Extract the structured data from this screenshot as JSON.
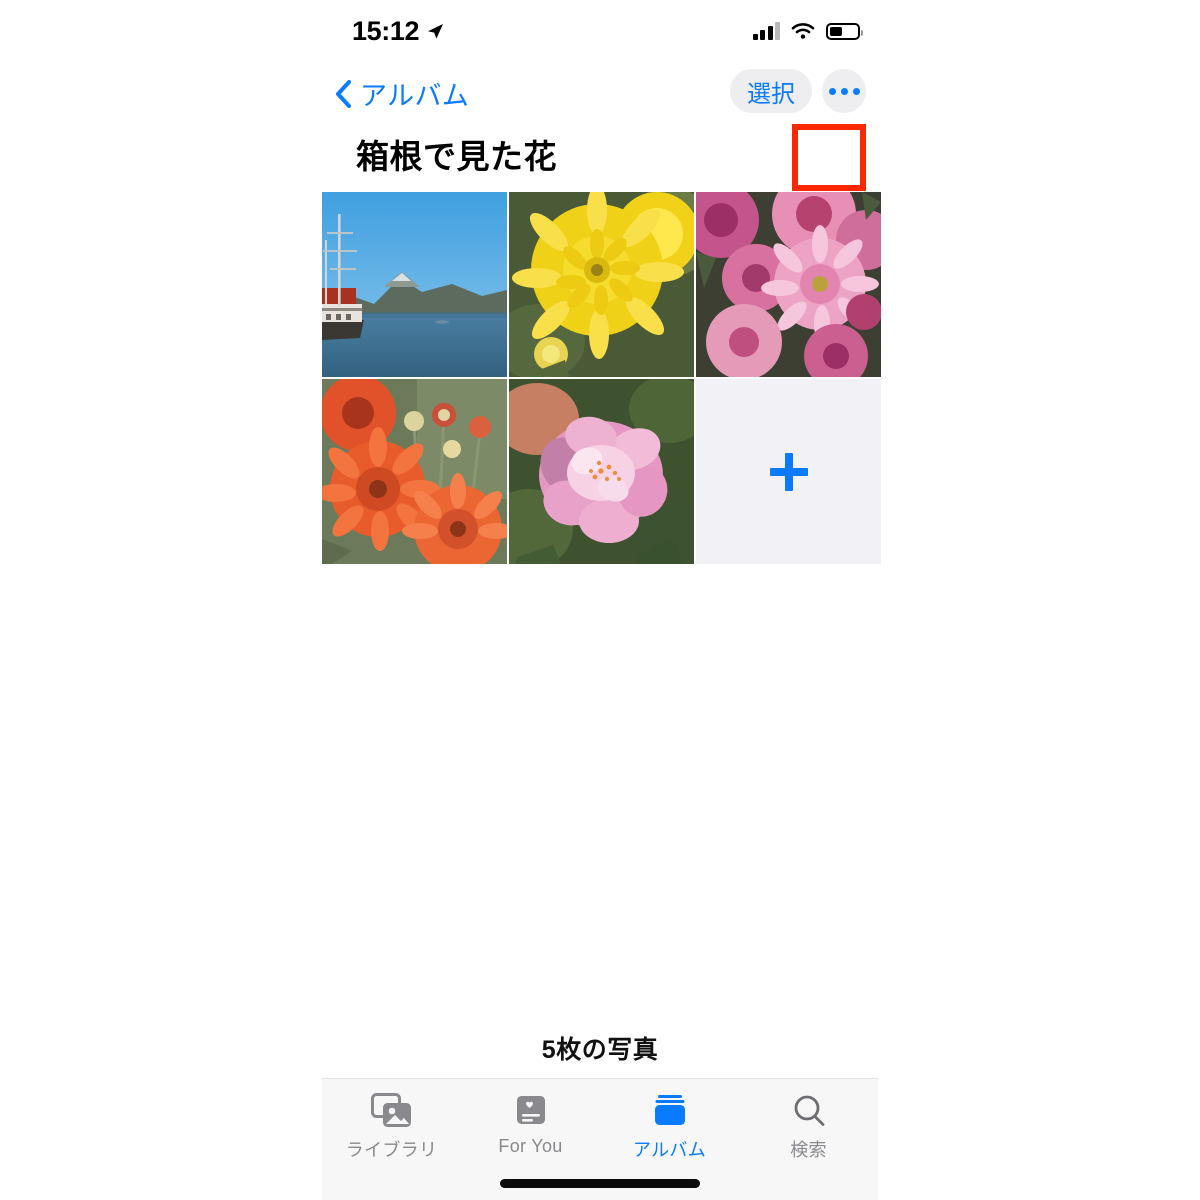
{
  "status_bar": {
    "time": "15:12",
    "location_icon": "location-arrow-icon",
    "signal_icon": "cellular-signal-icon",
    "wifi_icon": "wifi-icon",
    "battery_icon": "battery-icon",
    "battery_level_percent": 45
  },
  "nav_bar": {
    "back_label": "アルバム",
    "back_icon": "chevron-left-icon",
    "select_label": "選択",
    "more_icon": "ellipsis-icon",
    "highlight_color": "#fc2703",
    "accent_color": "#0a7bff"
  },
  "album": {
    "title": "箱根で見た花",
    "photo_count_label": "5枚の写真",
    "photos": [
      {
        "alt": "芦ノ湖と海賊船と山の風景",
        "name": "photo-lake-ship"
      },
      {
        "alt": "黄色い菊の花",
        "name": "photo-yellow-chrysanthemum"
      },
      {
        "alt": "ピンクの菊の花",
        "name": "photo-pink-chrysanthemum"
      },
      {
        "alt": "オレンジの菊の花",
        "name": "photo-orange-chrysanthemum"
      },
      {
        "alt": "ピンクのバラ",
        "name": "photo-pink-rose"
      }
    ],
    "add_cell": {
      "icon": "plus-icon",
      "background": "#f2f2f6"
    }
  },
  "tab_bar": {
    "items": [
      {
        "label": "ライブラリ",
        "icon": "photos-library-icon",
        "active": false
      },
      {
        "label": "For You",
        "icon": "for-you-card-icon",
        "active": false
      },
      {
        "label": "アルバム",
        "icon": "albums-stack-icon",
        "active": true
      },
      {
        "label": "検索",
        "icon": "magnifier-icon",
        "active": false
      }
    ]
  }
}
